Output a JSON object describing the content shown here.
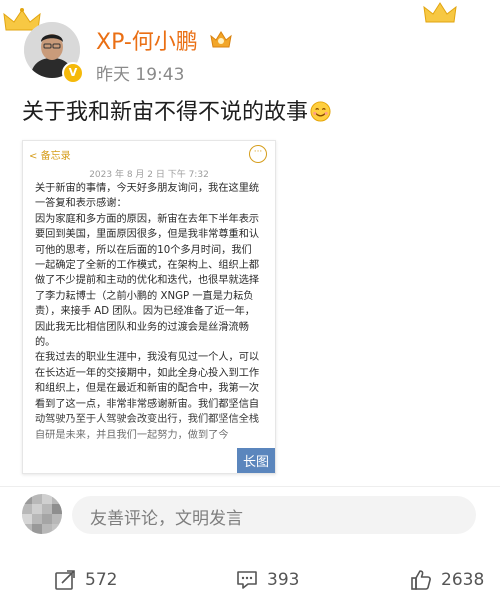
{
  "post": {
    "username": "XP-何小鹏",
    "time": "昨天 19:43",
    "text": "关于我和新宙不得不说的故事",
    "emoji_icon": "smile-emoji-icon"
  },
  "memo": {
    "back_label": "备忘录",
    "date": "2023 年 8 月 2 日 下午 7:32",
    "paragraphs": [
      "关于新宙的事情，今天好多朋友询问，我在这里统一答复和表示感谢：",
      "因为家庭和多方面的原因，新宙在去年下半年表示要回到美国，里面原因很多，但是我非常尊重和认可他的思考，所以在后面的10个多月时间，我们一起确定了全新的工作模式，在架构上、组织上都做了不少提前和主动的优化和迭代，也很早就选择了李力耘博士（之前小鹏的 XNGP 一直是力耘负责），来接手 AD 团队。因为已经准备了近一年，因此我无比相信团队和业务的过渡会是丝滑流畅的。",
      "在我过去的职业生涯中，我没有见过一个人，可以在长达近一年的交接期中，如此全身心投入到工作和组织上，但是在最近和新宙的配合中，我第一次看到了这一点，非常非常感谢新宙。我们都坚信自动驾驶乃至于人驾驶会改变出行，我们都坚信全栈自研是未来，并且我们一起努力，做到了今"
    ],
    "long_image_label": "长图"
  },
  "comment": {
    "placeholder": "友善评论，文明发言"
  },
  "actions": {
    "share_count": "572",
    "comment_count": "393",
    "like_count": "2638"
  },
  "colors": {
    "username": "#ea6f14",
    "vip_badge": "#f5b90a",
    "memo_accent": "#d59d1b"
  }
}
